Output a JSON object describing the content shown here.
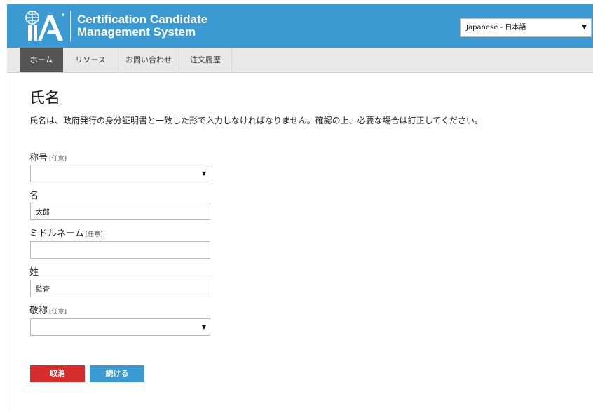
{
  "header": {
    "logo_text": "IIA",
    "title_line1": "Certification Candidate",
    "title_line2": "Management System",
    "language": {
      "selected": "Japanese - 日本語"
    },
    "background_color": "#3a9ad1"
  },
  "nav": {
    "items": [
      {
        "label": "ホーム",
        "active": true
      },
      {
        "label": "リソース",
        "active": false
      },
      {
        "label": "お問い合わせ",
        "active": false
      },
      {
        "label": "注文履歴",
        "active": false
      }
    ]
  },
  "page": {
    "title": "氏名",
    "intro": "氏名は、政府発行の身分証明書と一致した形で入力しなければなりません。確認の上、必要な場合は訂正してください。"
  },
  "form": {
    "optional_tag": "[任意]",
    "prefix": {
      "label": "称号",
      "value": ""
    },
    "first_name": {
      "label": "名",
      "value": "太郎"
    },
    "middle_name": {
      "label": "ミドルネーム",
      "value": ""
    },
    "last_name": {
      "label": "姓",
      "value": "監査"
    },
    "suffix": {
      "label": "敬称",
      "value": ""
    }
  },
  "buttons": {
    "cancel": "取消",
    "continue": "続ける",
    "cancel_color": "#d62c2c",
    "continue_color": "#3a9ad1"
  }
}
